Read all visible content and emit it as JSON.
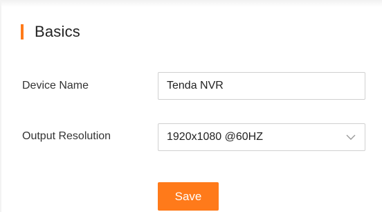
{
  "section": {
    "title": "Basics"
  },
  "form": {
    "device_name": {
      "label": "Device Name",
      "value": "Tenda NVR"
    },
    "output_resolution": {
      "label": "Output Resolution",
      "selected": "1920x1080 @60HZ"
    },
    "save_label": "Save"
  },
  "colors": {
    "accent": "#ff7a1a",
    "border": "#d0d0d0",
    "text": "#333333"
  },
  "icons": {
    "dropdown": "chevron-down-icon"
  }
}
